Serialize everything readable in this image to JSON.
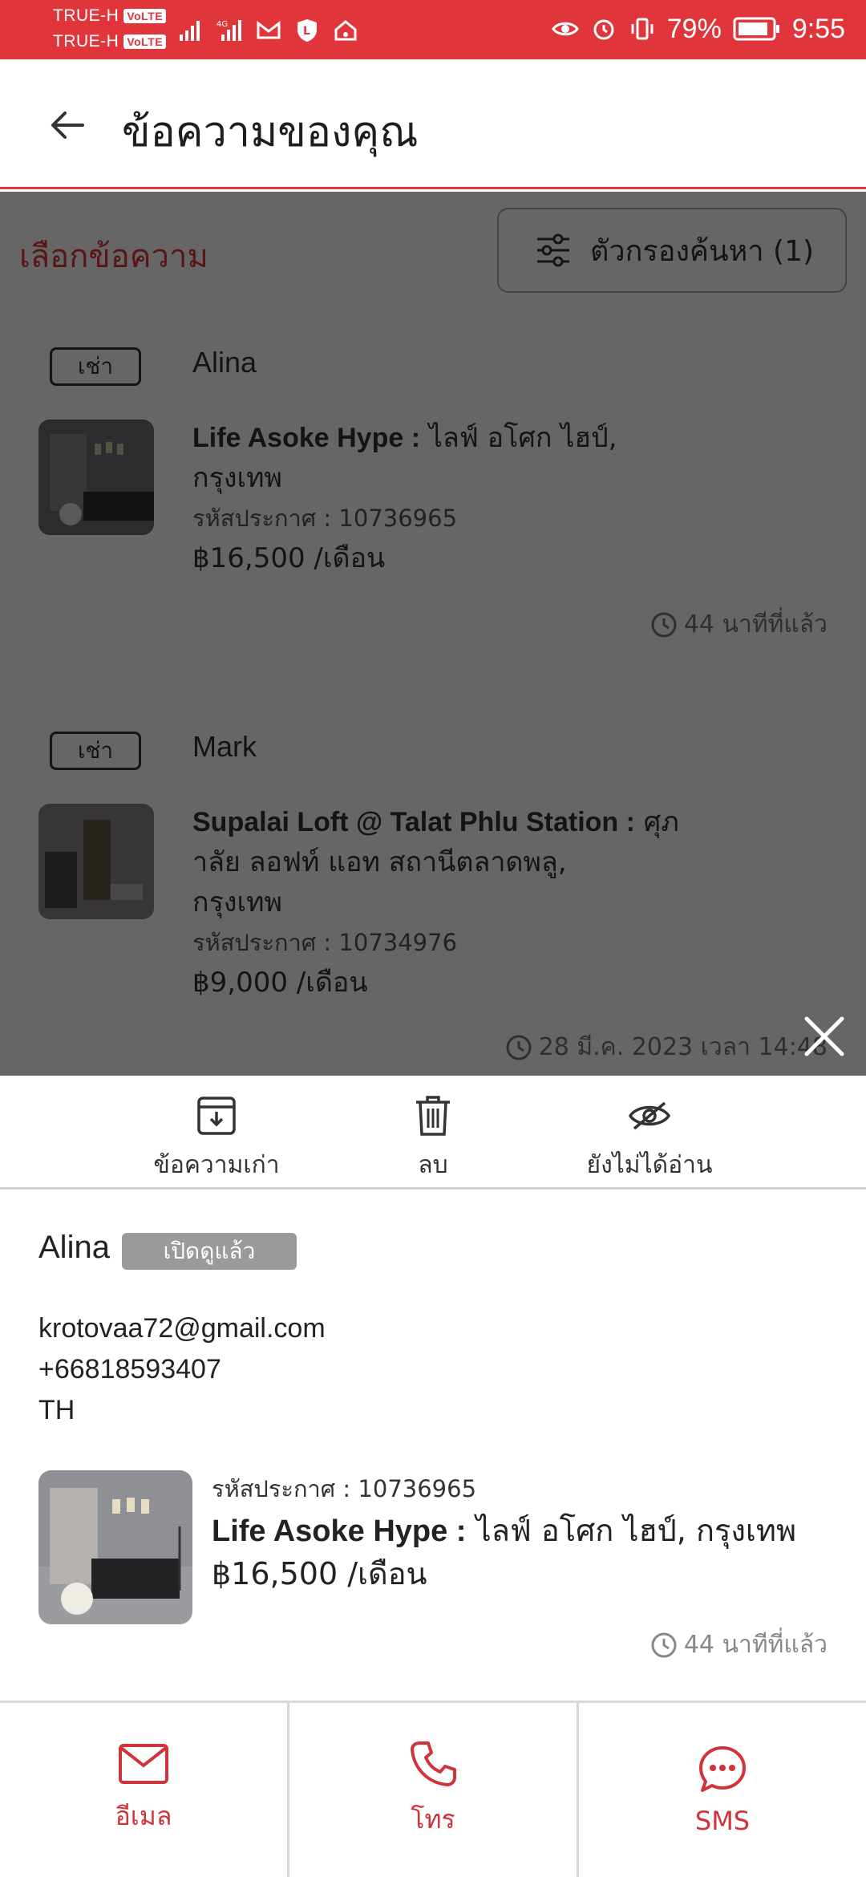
{
  "status_bar": {
    "carrier_1": "TRUE-H",
    "carrier_2": "TRUE-H",
    "volte": "VoLTE",
    "battery": "79%",
    "time": "9:55",
    "colors": {
      "background": "#e0353b"
    }
  },
  "header": {
    "title": "ข้อความของคุณ"
  },
  "toolbar": {
    "select_label": "เลือกข้อความ",
    "filter_label": "ตัวกรองค้นหา (1)"
  },
  "messages": [
    {
      "tag": "เช่า",
      "name": "Alina",
      "listing_name": "Life Asoke Hype :",
      "listing_thai": " ไลฟ์ อโศก ไฮป์,",
      "listing_city": "กรุงเทพ",
      "code": "รหัสประกาศ : 10736965",
      "price": "฿16,500 /เดือน",
      "time": "44 นาทีที่แล้ว"
    },
    {
      "tag": "เช่า",
      "name": "Mark",
      "listing_name": "Supalai Loft @ Talat Phlu Station :",
      "listing_thai": " ศุภ",
      "listing_thai_2": "าลัย ลอฟท์ แอท สถานีตลาดพลู,",
      "listing_city": "กรุงเทพ",
      "code": "รหัสประกาศ : 10734976",
      "price": "฿9,000 /เดือน",
      "time": "28 มี.ค. 2023 เวลา 14:48"
    }
  ],
  "sheet": {
    "actions": [
      {
        "label": "ข้อความเก่า",
        "icon": "archive-icon"
      },
      {
        "label": "ลบ",
        "icon": "trash-icon"
      },
      {
        "label": "ยังไม่ได้อ่าน",
        "icon": "eye-off-icon"
      }
    ],
    "sender": "Alina",
    "badge": "เปิดดูแล้ว",
    "email": "krotovaa72@gmail.com",
    "phone": "+66818593407",
    "country": "TH",
    "listing": {
      "code": "รหัสประกาศ : 10736965",
      "name": "Life Asoke Hype :",
      "thai": " ไลฟ์ อโศก ไฮป์, กรุงเทพ",
      "price": "฿16,500 /เดือน",
      "time": "44 นาทีที่แล้ว"
    },
    "contact_buttons": [
      {
        "label": "อีเมล",
        "icon": "mail-icon"
      },
      {
        "label": "โทร",
        "icon": "phone-icon"
      },
      {
        "label": "SMS",
        "icon": "sms-chat-icon"
      }
    ],
    "accent_color": "#d0343a"
  }
}
